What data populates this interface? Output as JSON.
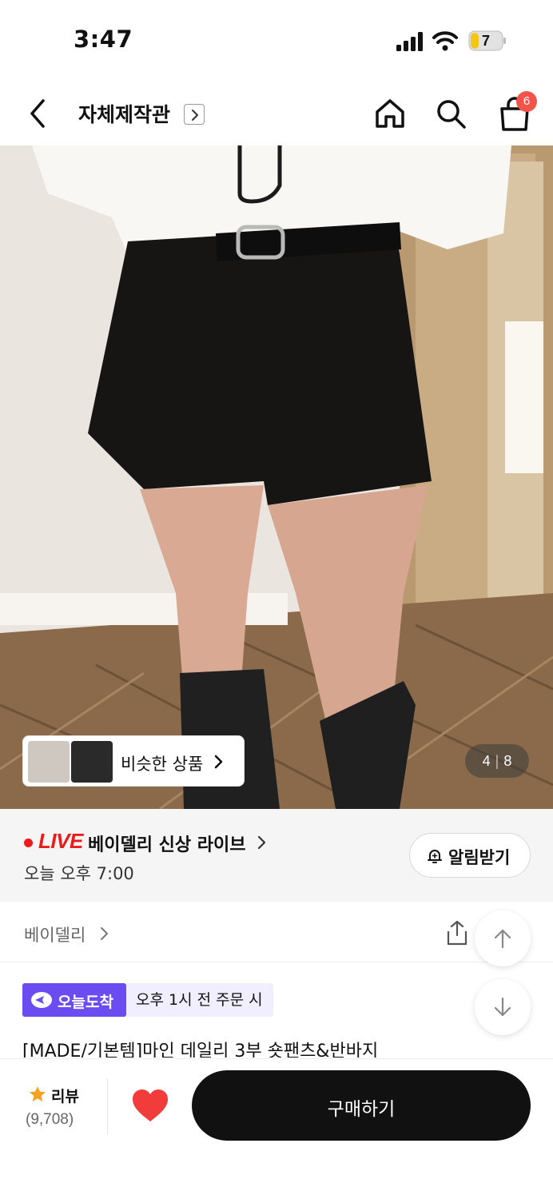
{
  "status_bar": {
    "time": "3:47",
    "battery_level": "7"
  },
  "header": {
    "shop_title": "자체제작관",
    "cart_badge": "6"
  },
  "product_image": {
    "similar_label": "비슷한 상품",
    "counter_current": "4",
    "counter_total": "8",
    "counter_separator": "|"
  },
  "live": {
    "badge": "LIVE",
    "title": "베이델리 신상 라이브",
    "time": "오늘 오후 7:00",
    "notify_label": "알림받기"
  },
  "brand": {
    "name": "베이델리"
  },
  "delivery": {
    "badge_label": "오늘도착",
    "order_note": "오후 1시 전 주문 시"
  },
  "product": {
    "title": "[MADE/기본템]마인 데일리 3부 숏팬츠&반바지"
  },
  "bottom_bar": {
    "review_label": "리뷰",
    "review_count": "(9,708)",
    "buy_label": "구매하기"
  },
  "colors": {
    "accent_purple": "#6a4cf0",
    "live_red": "#ee1a1a",
    "badge_red": "#f4534a",
    "heart_red": "#f23b3b",
    "star_orange": "#f6a21c"
  }
}
